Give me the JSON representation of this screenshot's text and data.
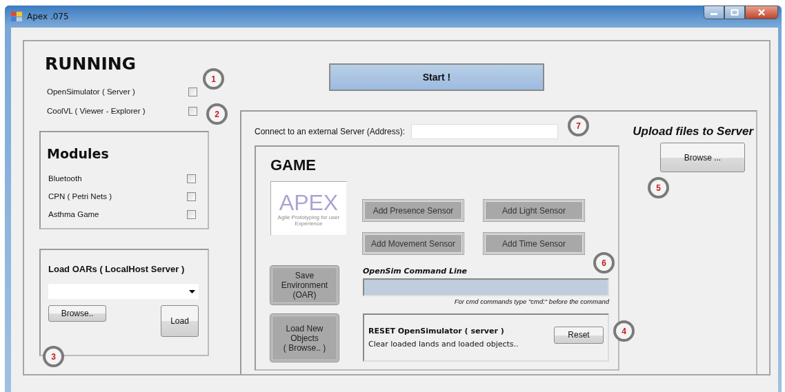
{
  "window": {
    "title": "Apex .075"
  },
  "running": {
    "title": "RUNNING",
    "items": [
      {
        "label": "OpenSimulator ( Server )",
        "checked": false
      },
      {
        "label": "CoolVL ( Viewer - Explorer )",
        "checked": false
      }
    ]
  },
  "start_button": "Start !",
  "modules": {
    "title": "Modules",
    "items": [
      {
        "label": "Bluetooth",
        "checked": false
      },
      {
        "label": "CPN ( Petri Nets )",
        "checked": false
      },
      {
        "label": "Asthma Game",
        "checked": false
      }
    ]
  },
  "load_oars": {
    "title": "Load OARs ( LocalHost Server )",
    "browse_button": "Browse..",
    "load_button": "Load"
  },
  "connect": {
    "label": "Connect to an external Server (Address):"
  },
  "upload": {
    "title": "Upload files to Server",
    "button": "Browse ..."
  },
  "game": {
    "title": "GAME",
    "logo": {
      "name": "APEX",
      "tagline": "Agile Prototyping for user Experience"
    },
    "sensor_buttons": [
      "Add Presence Sensor",
      "Add Light Sensor",
      "Add Movement Sensor",
      "Add Time Sensor"
    ],
    "save_button": "Save\nEnvironment\n(OAR)",
    "load_objects_button": "Load New\nObjects\n( Browse.. )",
    "command_line": {
      "title": "OpenSim Command Line",
      "hint": "For cmd commands type \"cmd:\" before the command"
    },
    "reset": {
      "title": "RESET OpenSimulator ( server )",
      "description": "Clear loaded lands and loaded objects..",
      "button": "Reset"
    }
  },
  "callouts": [
    "1",
    "2",
    "3",
    "4",
    "5",
    "6",
    "7"
  ]
}
